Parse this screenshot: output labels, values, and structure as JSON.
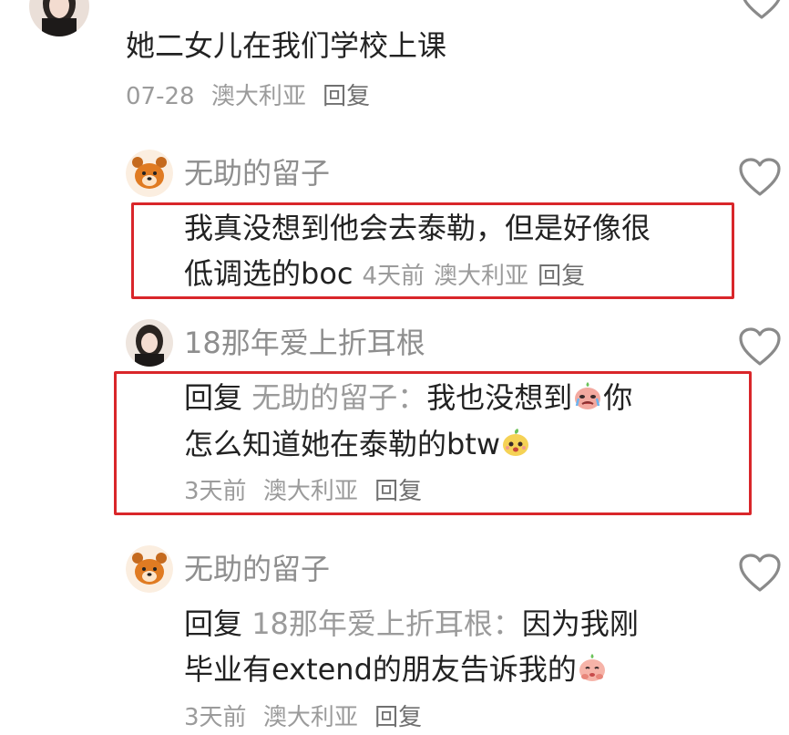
{
  "comments": [
    {
      "text": "她二女儿在我们学校上课",
      "date": "07-28",
      "location": "澳大利亚",
      "reply_label": "回复"
    },
    {
      "username": "无助的留子",
      "line1": "我真没想到他会去泰勒，但是好像很",
      "line2": "低调选的boc",
      "date": "4天前",
      "location": "澳大利亚",
      "reply_label": "回复"
    },
    {
      "username": "18那年爱上折耳根",
      "reply_prefix": "回复",
      "reply_to": "无助的留子：",
      "line1": "我也没想到",
      "line1_end": "你",
      "line2": "怎么知道她在泰勒的btw",
      "date": "3天前",
      "location": "澳大利亚",
      "reply_label": "回复"
    },
    {
      "username": "无助的留子",
      "reply_prefix": "回复",
      "reply_to": "18那年爱上折耳根：",
      "line1": "因为我刚",
      "line2": "毕业有extend的朋友告诉我的",
      "date": "3天前",
      "location": "澳大利亚",
      "reply_label": "回复"
    }
  ],
  "colors": {
    "highlight_border": "#d9262a",
    "username": "#8e8e8e",
    "meta": "#9b9b9b"
  }
}
